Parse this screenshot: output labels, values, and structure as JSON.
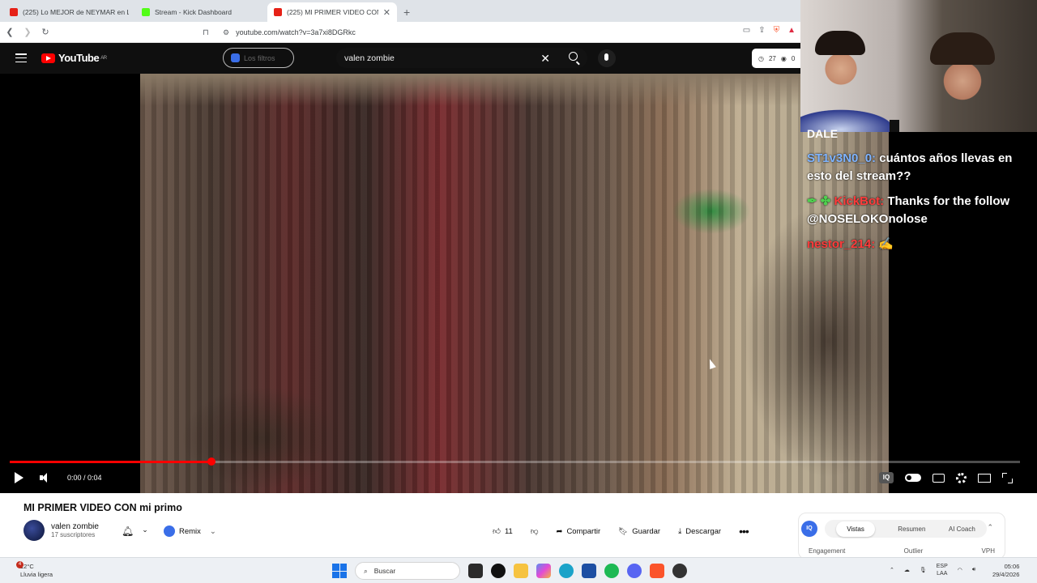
{
  "browser": {
    "tabs": [
      {
        "title": "(225) Lo MEJOR de NEYMAR en LALIGA",
        "color": "#e62117"
      },
      {
        "title": "Stream - Kick Dashboard",
        "color": "#53fc18"
      },
      {
        "title": "(225) MI PRIMER VIDEO CON",
        "color": "#e62117"
      }
    ],
    "url": "youtube.com/watch?v=3a7xi8DGRkc"
  },
  "youtube": {
    "logo": "YouTube",
    "region": "AR",
    "filters_label": "Los filtros",
    "search_value": "valen zombie",
    "vph_counts": [
      "27",
      "0"
    ]
  },
  "player": {
    "time": "0:00 / 0:04",
    "progress_fraction": 0.2
  },
  "chat": {
    "partial": "DALE",
    "messages": [
      {
        "user": "ST1v3N0_0:",
        "user_color": "#7fb4ff",
        "text": " cuántos años llevas en esto del stream??"
      },
      {
        "user": "KickBot:",
        "user_color": "#ff3b3b",
        "prefix": "✒ ✤ ",
        "text": " Thanks for the follow @NOSELOKOnolose"
      },
      {
        "user": "nestor_214:",
        "user_color": "#ff3b3b",
        "text": " ✍"
      }
    ]
  },
  "video": {
    "title": "MI PRIMER VIDEO CON mi primo",
    "channel": "valen zombie",
    "subscribers": "17 suscriptores",
    "remix_label": "Remix",
    "likes": "11",
    "share_label": "Compartir",
    "save_label": "Guardar",
    "download_label": "Descargar"
  },
  "iq_panel": {
    "logo": "IQ",
    "tabs": [
      "Vistas",
      "Resumen",
      "AI Coach"
    ],
    "metrics": [
      "Engagement",
      "Outlier",
      "VPH"
    ]
  },
  "taskbar": {
    "weather_temp": "12°C",
    "weather_desc": "Lluvia ligera",
    "notification_count": "4",
    "search_placeholder": "Buscar",
    "lang": "ESP",
    "lang2": "LAA",
    "time": "05:06",
    "date": "29/4/2026"
  }
}
